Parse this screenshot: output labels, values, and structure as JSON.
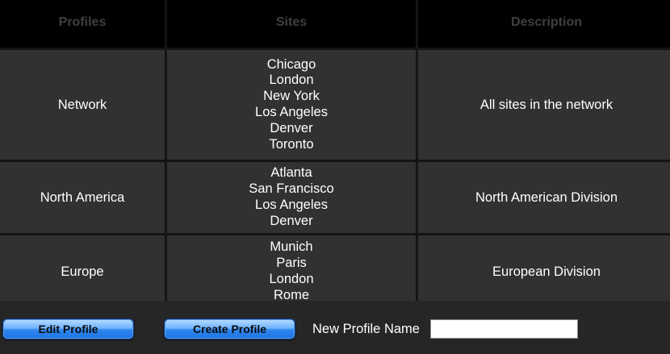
{
  "table": {
    "headers": [
      "Profiles",
      "Sites",
      "Description"
    ],
    "rows": [
      {
        "profile": "Network",
        "sites": [
          "Chicago",
          "London",
          "New York",
          "Los Angeles",
          "Denver",
          "Toronto"
        ],
        "description": "All sites in the network"
      },
      {
        "profile": "North America",
        "sites": [
          "Atlanta",
          "San Francisco",
          "Los Angeles",
          "Denver"
        ],
        "description": "North American Division"
      },
      {
        "profile": "Europe",
        "sites": [
          "Munich",
          "Paris",
          "London",
          "Rome"
        ],
        "description": "European Division"
      }
    ]
  },
  "toolbar": {
    "edit_label": "Edit Profile",
    "create_label": "Create Profile",
    "new_name_label": "New Profile Name",
    "new_name_value": ""
  },
  "colors": {
    "header_bg": "#000000",
    "header_text": "#3f3f3f",
    "cell_bg": "#313131",
    "button_blue": "#2f86ee"
  }
}
